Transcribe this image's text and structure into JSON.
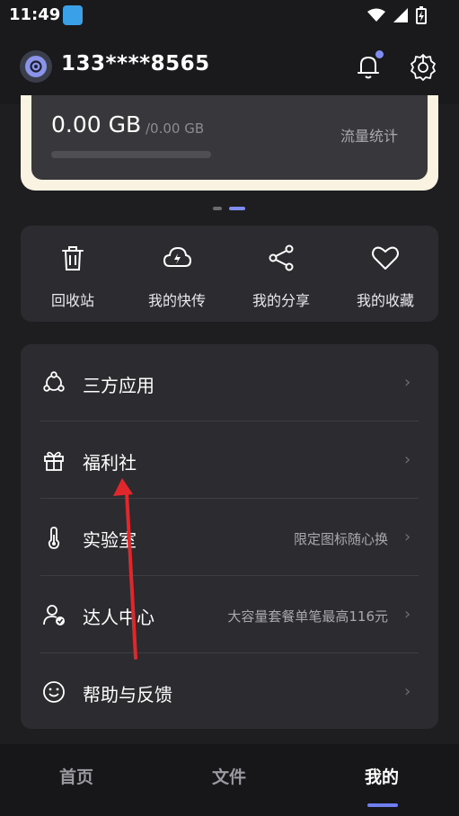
{
  "status": {
    "time": "11:49"
  },
  "header": {
    "phone": "133****8565"
  },
  "storage": {
    "used": "0.00 GB",
    "total": "/0.00 GB",
    "stats_link": "流量统计",
    "used_fraction": 0
  },
  "carousel": {
    "pages": 2,
    "active": 2
  },
  "shortcuts": [
    {
      "label": "回收站",
      "icon": "trash-icon"
    },
    {
      "label": "我的快传",
      "icon": "cloud-upload-icon"
    },
    {
      "label": "我的分享",
      "icon": "share-icon"
    },
    {
      "label": "我的收藏",
      "icon": "heart-icon"
    }
  ],
  "menu": [
    {
      "label": "三方应用",
      "hint": "",
      "icon": "third-party-apps-icon"
    },
    {
      "label": "福利社",
      "hint": "",
      "icon": "gift-icon"
    },
    {
      "label": "实验室",
      "hint": "限定图标随心换",
      "icon": "thermometer-icon"
    },
    {
      "label": "达人中心",
      "hint": "大容量套餐单笔最高116元",
      "icon": "expert-user-icon"
    },
    {
      "label": "帮助与反馈",
      "hint": "",
      "icon": "smile-icon"
    }
  ],
  "tabs": [
    {
      "label": "首页"
    },
    {
      "label": "文件"
    },
    {
      "label": "我的"
    }
  ],
  "colors": {
    "accent": "#7f8cf0",
    "annotation_arrow": "#e0282c",
    "card_border": "#fbf3e2"
  }
}
